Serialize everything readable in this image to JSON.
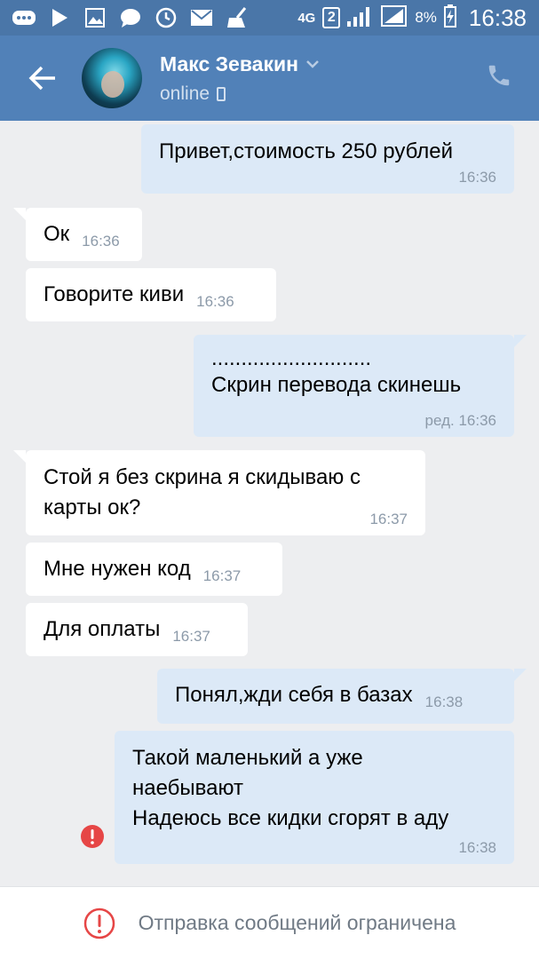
{
  "status_bar": {
    "network": "4G",
    "sim_badge": "2",
    "battery": "8%",
    "time": "16:38",
    "icons": [
      "more-icon",
      "play-icon",
      "gallery-icon",
      "chat-icon",
      "clock-icon",
      "mail-icon",
      "broom-icon"
    ]
  },
  "header": {
    "name": "Макс Зевакин",
    "status": "online"
  },
  "messages": [
    {
      "dir": "out",
      "text": "Привет,стоимость 250 рублей",
      "time": "16:36"
    },
    {
      "dir": "in",
      "text": "Ок",
      "time": "16:36"
    },
    {
      "dir": "in",
      "text": "Говорите киви",
      "time": "16:36"
    },
    {
      "dir": "out",
      "line1": "...........................",
      "line2": "Скрин перевода скинешь",
      "time": "ред. 16:36"
    },
    {
      "dir": "in",
      "line1": "Стой я без скрина я скидываю с",
      "line2": "карты ок?",
      "time": "16:37"
    },
    {
      "dir": "in",
      "text": "Мне нужен код",
      "time": "16:37"
    },
    {
      "dir": "in",
      "text": "Для оплаты",
      "time": "16:37"
    },
    {
      "dir": "out",
      "text": "Понял,жди себя в базах",
      "time": "16:38"
    },
    {
      "dir": "out",
      "line1": "Такой маленький а уже",
      "line2": "наебывают",
      "line3": "Надеюсь все кидки сгорят в аду",
      "time": "16:38",
      "status": "failed"
    }
  ],
  "bottom": {
    "restriction_text": "Отправка сообщений ограничена"
  },
  "colors": {
    "header": "#5181b8",
    "status_bar": "#4a76a8",
    "background": "#edeef0",
    "outgoing_bubble": "#dce9f7",
    "incoming_bubble": "#ffffff",
    "error": "#e64646"
  }
}
